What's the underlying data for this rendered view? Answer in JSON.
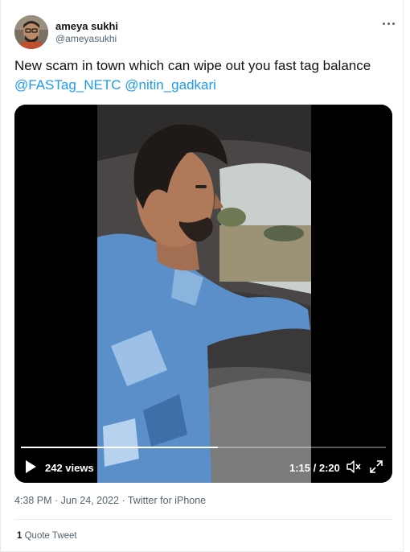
{
  "author": {
    "display_name": "ameya sukhi",
    "handle": "@ameyasukhi",
    "avatar_icon": "profile-photo"
  },
  "tweet": {
    "text": "New scam in town which can wipe out you fast tag balance ",
    "mentions": [
      "@FASTag_NETC",
      "@nitin_gadkari"
    ]
  },
  "video": {
    "views": "242 views",
    "time": "1:15 / 2:20",
    "progress": 0.54,
    "icons": {
      "play": "play-icon",
      "mute": "volume-mute-icon",
      "fullscreen": "fullscreen-icon"
    }
  },
  "meta": {
    "time": "4:38 PM",
    "date": "Jun 24, 2022",
    "source": "Twitter for iPhone",
    "separator": " · "
  },
  "stats": {
    "quote_count": "1",
    "quote_label": "Quote Tweet"
  },
  "colors": {
    "link": "#1d9bf0",
    "secondary_text": "#536471",
    "primary_text": "#0f1419"
  }
}
